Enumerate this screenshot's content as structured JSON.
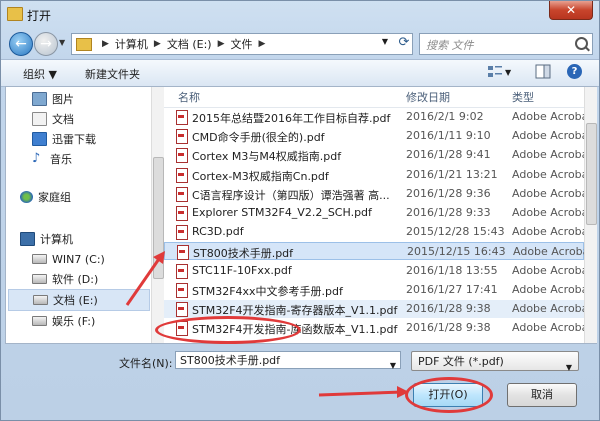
{
  "window": {
    "title": "打开"
  },
  "nav": {
    "breadcrumbs": [
      "计算机",
      "文档 (E:)",
      "文件"
    ],
    "search_placeholder": "搜索 文件"
  },
  "toolbar": {
    "organize": "组织 ▼",
    "new_folder": "新建文件夹"
  },
  "sidebar": {
    "items": [
      {
        "label": "图片",
        "icon": "pictures-icon"
      },
      {
        "label": "文档",
        "icon": "documents-icon"
      },
      {
        "label": "迅雷下载",
        "icon": "thunder-download-icon"
      },
      {
        "label": "音乐",
        "icon": "music-icon"
      },
      {
        "label": "家庭组",
        "icon": "homegroup-icon"
      },
      {
        "label": "计算机",
        "icon": "computer-icon"
      },
      {
        "label": "WIN7 (C:)",
        "icon": "drive-icon"
      },
      {
        "label": "软件 (D:)",
        "icon": "drive-icon"
      },
      {
        "label": "文档 (E:)",
        "icon": "drive-icon",
        "selected": true
      },
      {
        "label": "娱乐 (F:)",
        "icon": "drive-icon"
      }
    ]
  },
  "filelist": {
    "columns": {
      "name": "名称",
      "date": "修改日期",
      "type": "类型"
    },
    "files": [
      {
        "name": "2015年总结暨2016年工作目标自荐.pdf",
        "date": "2016/2/1 9:02",
        "type": "Adobe Acroba"
      },
      {
        "name": "CMD命令手册(很全的).pdf",
        "date": "2016/1/11 9:10",
        "type": "Adobe Acroba"
      },
      {
        "name": "Cortex M3与M4权威指南.pdf",
        "date": "2016/1/28 9:41",
        "type": "Adobe Acroba"
      },
      {
        "name": "Cortex-M3权威指南Cn.pdf",
        "date": "2016/1/21 13:21",
        "type": "Adobe Acroba"
      },
      {
        "name": "C语言程序设计（第四版）谭浩强著 高...",
        "date": "2016/1/28 9:36",
        "type": "Adobe Acroba"
      },
      {
        "name": "Explorer STM32F4_V2.2_SCH.pdf",
        "date": "2016/1/28 9:33",
        "type": "Adobe Acroba"
      },
      {
        "name": "RC3D.pdf",
        "date": "2015/12/28 15:43",
        "type": "Adobe Acroba"
      },
      {
        "name": "ST800技术手册.pdf",
        "date": "2015/12/15 16:43",
        "type": "Adobe Acroba",
        "selected": true
      },
      {
        "name": "STC11F-10Fxx.pdf",
        "date": "2016/1/18 13:55",
        "type": "Adobe Acroba"
      },
      {
        "name": "STM32F4xx中文参考手册.pdf",
        "date": "2016/1/27 17:41",
        "type": "Adobe Acroba"
      },
      {
        "name": "STM32F4开发指南-寄存器版本_V1.1.pdf",
        "date": "2016/1/28 9:38",
        "type": "Adobe Acroba",
        "highlight": true
      },
      {
        "name": "STM32F4开发指南-库函数版本_V1.1.pdf",
        "date": "2016/1/28 9:38",
        "type": "Adobe Acroba"
      }
    ]
  },
  "bottom": {
    "filename_label": "文件名(N):",
    "filename_value": "ST800技术手册.pdf",
    "filetype_value": "PDF 文件 (*.pdf)",
    "open_label": "打开(O)",
    "cancel_label": "取消"
  },
  "colors": {
    "annotation": "#e03a3a",
    "selection": "#d5e5f8",
    "accent": "#2a66b6"
  }
}
